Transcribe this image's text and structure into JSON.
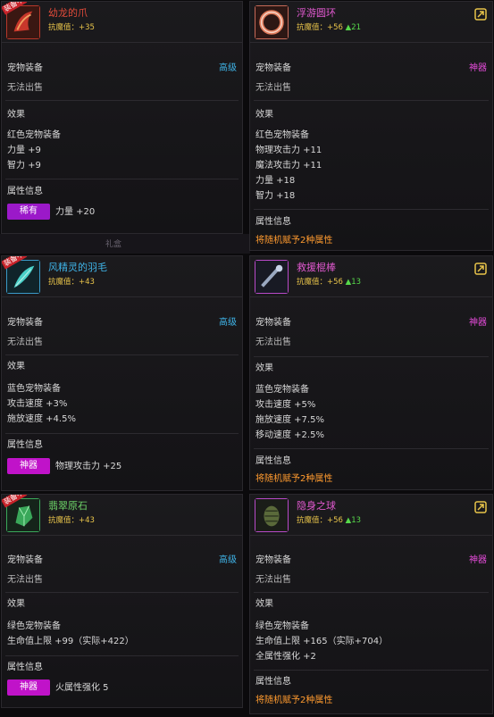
{
  "cards": [
    {
      "name": "幼龙的爪",
      "name_color": "#e24b3a",
      "tag": "装备中",
      "resist_label": "抗魔值：+35",
      "resist_plus": "",
      "category": "宠物装备",
      "grade": "高级",
      "grade_color": "#3fb4e8",
      "sell": "无法出售",
      "effect_title": "效果",
      "effects": [
        "红色宠物装备",
        "力量 +9",
        "智力 +9"
      ],
      "attr_title": "属性信息",
      "badge": "稀有",
      "attr_value": "力量 +20",
      "random_text": "",
      "icon": "dragon-claw-icon"
    },
    {
      "name": "浮游圆环",
      "name_color": "#e35ad1",
      "tag": "",
      "resist_label": "抗魔值：+56",
      "resist_plus": "▲21",
      "category": "宠物装备",
      "grade": "神器",
      "grade_color": "#e34bd8",
      "sell": "无法出售",
      "effect_title": "效果",
      "effects": [
        "红色宠物装备",
        "物理攻击力 +11",
        "魔法攻击力 +11",
        "力量 +18",
        "智力 +18"
      ],
      "attr_title": "属性信息",
      "badge": "",
      "attr_value": "",
      "random_text": "将随机赋予2种属性",
      "icon": "floating-ring-icon"
    },
    {
      "name": "风精灵的羽毛",
      "name_color": "#3fb4e8",
      "tag": "装备中",
      "resist_label": "抗魔值：+43",
      "resist_plus": "",
      "category": "宠物装备",
      "grade": "高级",
      "grade_color": "#3fb4e8",
      "sell": "无法出售",
      "effect_title": "效果",
      "effects": [
        "蓝色宠物装备",
        "攻击速度 +3%",
        "施放速度 +4.5%"
      ],
      "attr_title": "属性信息",
      "badge": "神器",
      "attr_value": "物理攻击力 +25",
      "random_text": "",
      "icon": "feather-icon"
    },
    {
      "name": "救援棍棒",
      "name_color": "#e35ad1",
      "tag": "",
      "resist_label": "抗魔值：+56",
      "resist_plus": "▲13",
      "category": "宠物装备",
      "grade": "神器",
      "grade_color": "#e34bd8",
      "sell": "无法出售",
      "effect_title": "效果",
      "effects": [
        "蓝色宠物装备",
        "攻击速度 +5%",
        "施放速度 +7.5%",
        "移动速度 +2.5%"
      ],
      "attr_title": "属性信息",
      "badge": "",
      "attr_value": "",
      "random_text": "将随机赋予2种属性",
      "icon": "rescue-club-icon"
    },
    {
      "name": "翡翠原石",
      "name_color": "#6fd86a",
      "tag": "装备中",
      "resist_label": "抗魔值：+43",
      "resist_plus": "",
      "category": "宠物装备",
      "grade": "高级",
      "grade_color": "#3fb4e8",
      "sell": "无法出售",
      "effect_title": "效果",
      "effects": [
        "绿色宠物装备",
        "生命值上限 +99（实际+422）"
      ],
      "attr_title": "属性信息",
      "badge": "神器",
      "attr_value": "火属性强化 5",
      "random_text": "",
      "icon": "emerald-ore-icon"
    },
    {
      "name": "隐身之球",
      "name_color": "#e35ad1",
      "tag": "",
      "resist_label": "抗魔值：+56",
      "resist_plus": "▲13",
      "category": "宠物装备",
      "grade": "神器",
      "grade_color": "#e34bd8",
      "sell": "无法出售",
      "effect_title": "效果",
      "effects": [
        "绿色宠物装备",
        "生命值上限 +165（实际+704）",
        "全属性强化 +2"
      ],
      "attr_title": "属性信息",
      "badge": "",
      "attr_value": "",
      "random_text": "将随机赋予2种属性",
      "icon": "stealth-orb-icon"
    }
  ],
  "background_label": "礼盒"
}
